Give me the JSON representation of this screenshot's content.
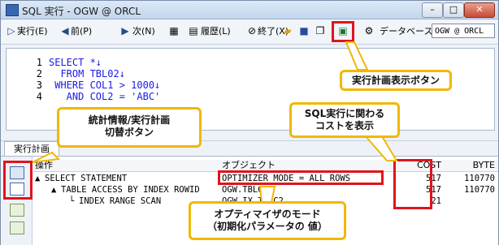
{
  "window": {
    "title": "SQL 実行 - OGW @ ORCL",
    "buttons": {
      "minimize": "–",
      "maximize": "□",
      "close": "✕"
    }
  },
  "toolbar": {
    "execute": "実行(E)",
    "prev": "前(P)",
    "next": "次(N)",
    "history": "履歴(L)",
    "end": "終了(X)",
    "database_label": "データベース",
    "database_value": "OGW @ ORCL"
  },
  "editor": {
    "lines": [
      {
        "no": "1",
        "text": "SELECT *↓"
      },
      {
        "no": "2",
        "text": "  FROM TBL02↓"
      },
      {
        "no": "3",
        "text": " WHERE COL1 > 1000↓"
      },
      {
        "no": "4",
        "text": "   AND COL2 = 'ABC'"
      }
    ]
  },
  "tabs": {
    "plan": "実行計画"
  },
  "plan_grid": {
    "headers": {
      "operation": "操作",
      "object": "オブジェクト",
      "cost": "COST",
      "byte": "BYTE"
    },
    "rows": [
      {
        "operation": "SELECT STATEMENT",
        "object": "OPTIMIZER_MODE = ALL_ROWS",
        "cost": "517",
        "byte": "110770"
      },
      {
        "operation": "TABLE ACCESS BY INDEX ROWID",
        "object": "OGW.TBL02",
        "cost": "517",
        "byte": "110770"
      },
      {
        "operation": "INDEX RANGE SCAN",
        "object": "OGW.IX_T2_C2",
        "cost": "21",
        "byte": ""
      }
    ]
  },
  "callouts": {
    "plan_button": "実行計画表示ボタン",
    "cost_line1": "SQL実行に関わる",
    "cost_line2": "コストを表示",
    "toggle_line1": "統計情報/実行計画",
    "toggle_line2": "切替ボタン",
    "optimizer_line1": "オプティマイザのモード",
    "optimizer_line2": "（初期化パラメータの 値）"
  },
  "colors": {
    "highlight": "#e0141b",
    "callout_border": "#f0b800"
  }
}
